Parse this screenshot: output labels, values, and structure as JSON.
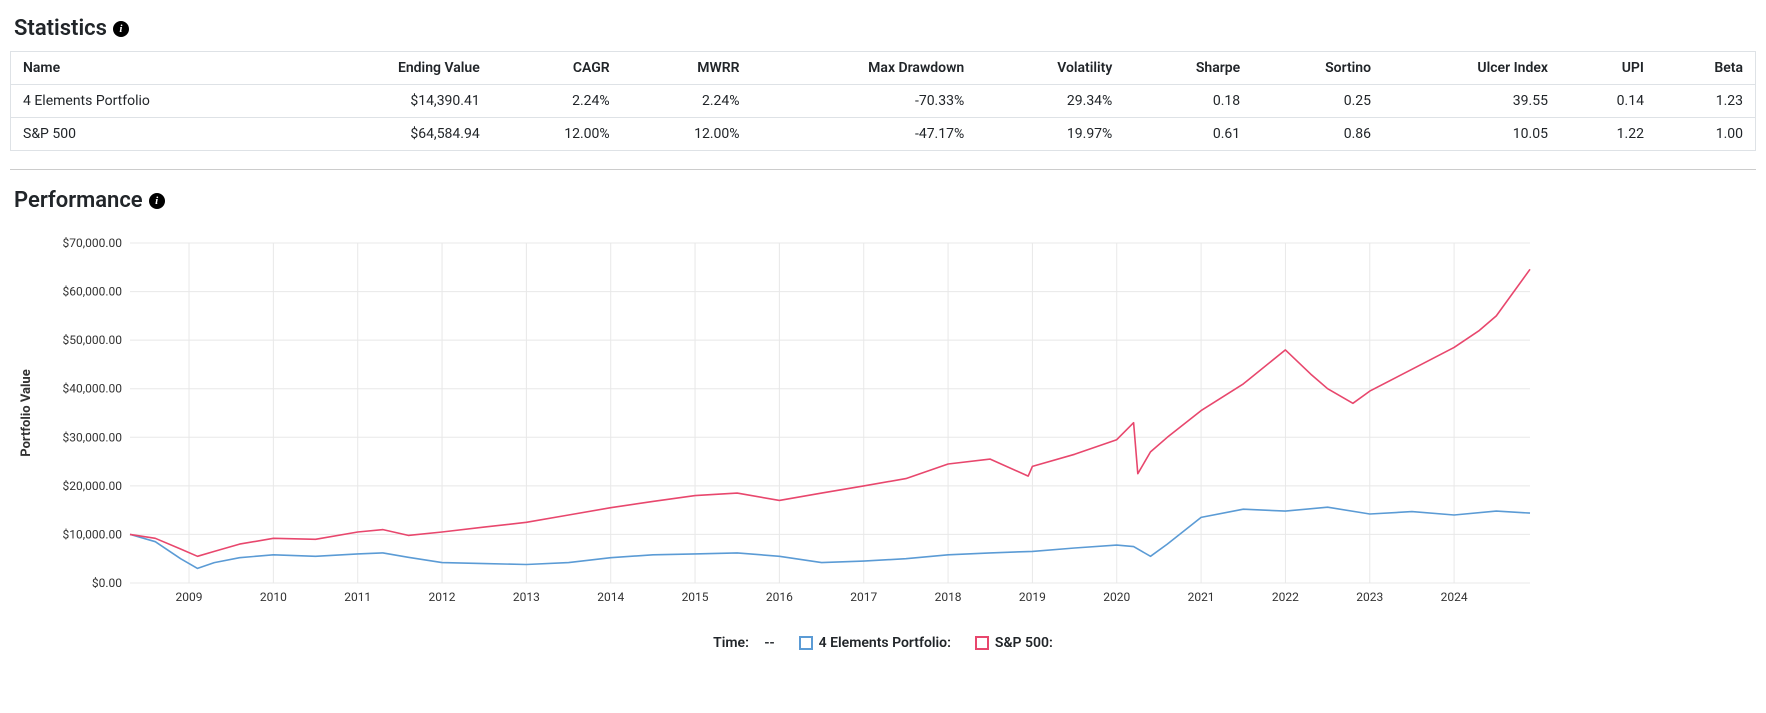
{
  "statistics": {
    "title": "Statistics",
    "columns": [
      "Name",
      "Ending Value",
      "CAGR",
      "MWRR",
      "Max Drawdown",
      "Volatility",
      "Sharpe",
      "Sortino",
      "Ulcer Index",
      "UPI",
      "Beta"
    ],
    "rows": [
      {
        "name": "4 Elements Portfolio",
        "ending_value": "$14,390.41",
        "cagr": "2.24%",
        "mwrr": "2.24%",
        "max_drawdown": "-70.33%",
        "volatility": "29.34%",
        "sharpe": "0.18",
        "sortino": "0.25",
        "ulcer": "39.55",
        "upi": "0.14",
        "beta": "1.23"
      },
      {
        "name": "S&P 500",
        "ending_value": "$64,584.94",
        "cagr": "12.00%",
        "mwrr": "12.00%",
        "max_drawdown": "-47.17%",
        "volatility": "19.97%",
        "sharpe": "0.61",
        "sortino": "0.86",
        "ulcer": "10.05",
        "upi": "1.22",
        "beta": "1.00"
      }
    ]
  },
  "performance": {
    "title": "Performance",
    "ylabel": "Portfolio Value",
    "legend_time_label": "Time:",
    "legend_time_value": "--",
    "legend_series1": "4 Elements Portfolio:",
    "legend_series2": "S&P 500:",
    "colors": {
      "series1": "#5b9bd5",
      "series2": "#e8476d"
    },
    "yticks": [
      "$0.00",
      "$10,000.00",
      "$20,000.00",
      "$30,000.00",
      "$40,000.00",
      "$50,000.00",
      "$60,000.00",
      "$70,000.00"
    ],
    "xticks": [
      "2009",
      "2010",
      "2011",
      "2012",
      "2013",
      "2014",
      "2015",
      "2016",
      "2017",
      "2018",
      "2019",
      "2020",
      "2021",
      "2022",
      "2023",
      "2024"
    ]
  },
  "chart_data": {
    "type": "line",
    "title": "Performance",
    "xlabel": "",
    "ylabel": "Portfolio Value",
    "xlim": [
      2008.3,
      2024.9
    ],
    "ylim": [
      0,
      70000
    ],
    "series": [
      {
        "name": "4 Elements Portfolio",
        "color": "#5b9bd5",
        "x": [
          2008.3,
          2008.6,
          2008.9,
          2009.1,
          2009.3,
          2009.6,
          2010.0,
          2010.5,
          2011.0,
          2011.3,
          2011.6,
          2012.0,
          2012.5,
          2013.0,
          2013.5,
          2014.0,
          2014.5,
          2015.0,
          2015.5,
          2016.0,
          2016.5,
          2017.0,
          2017.5,
          2018.0,
          2018.5,
          2019.0,
          2019.5,
          2020.0,
          2020.2,
          2020.4,
          2020.6,
          2021.0,
          2021.5,
          2022.0,
          2022.5,
          2023.0,
          2023.5,
          2024.0,
          2024.5,
          2024.9
        ],
        "values": [
          10000,
          8500,
          5000,
          3000,
          4200,
          5200,
          5800,
          5500,
          6000,
          6200,
          5300,
          4200,
          4000,
          3800,
          4200,
          5200,
          5800,
          6000,
          6200,
          5500,
          4200,
          4500,
          5000,
          5800,
          6200,
          6500,
          7200,
          7800,
          7500,
          5500,
          8000,
          13500,
          15200,
          14800,
          15600,
          14200,
          14700,
          14000,
          14800,
          14390
        ]
      },
      {
        "name": "S&P 500",
        "color": "#e8476d",
        "x": [
          2008.3,
          2008.6,
          2008.9,
          2009.1,
          2009.3,
          2009.6,
          2010.0,
          2010.5,
          2011.0,
          2011.3,
          2011.6,
          2012.0,
          2012.5,
          2013.0,
          2013.5,
          2014.0,
          2014.5,
          2015.0,
          2015.5,
          2016.0,
          2016.5,
          2017.0,
          2017.5,
          2018.0,
          2018.5,
          2018.95,
          2019.0,
          2019.5,
          2020.0,
          2020.2,
          2020.25,
          2020.4,
          2020.6,
          2021.0,
          2021.5,
          2022.0,
          2022.3,
          2022.5,
          2022.8,
          2023.0,
          2023.5,
          2024.0,
          2024.3,
          2024.5,
          2024.9
        ],
        "values": [
          10000,
          9200,
          7000,
          5500,
          6500,
          8000,
          9200,
          9000,
          10500,
          11000,
          9800,
          10500,
          11500,
          12500,
          14000,
          15500,
          16800,
          18000,
          18500,
          17000,
          18500,
          20000,
          21500,
          24500,
          25500,
          22000,
          24000,
          26500,
          29500,
          33000,
          22500,
          27000,
          30000,
          35500,
          41000,
          48000,
          43000,
          40000,
          37000,
          39500,
          44000,
          48500,
          52000,
          55000,
          64585
        ]
      }
    ]
  }
}
